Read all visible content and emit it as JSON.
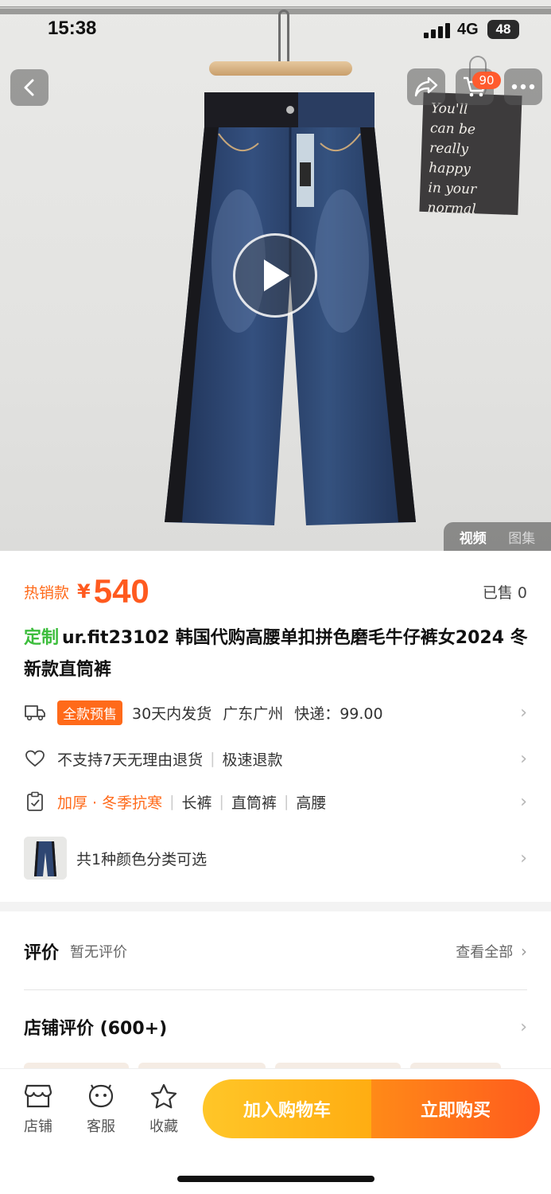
{
  "status_bar": {
    "time": "15:38",
    "network": "4G",
    "battery": "48"
  },
  "top_nav": {
    "cart_badge": "90"
  },
  "hero": {
    "card_text": [
      "You'll",
      "can be really",
      "happy",
      "in your",
      "normal"
    ],
    "media_tabs": [
      "视频",
      "图集"
    ],
    "active_tab": "视频"
  },
  "product": {
    "hot_label": "热销款",
    "currency": "¥",
    "price": "540",
    "sold": "已售 0",
    "title_tag": "定制",
    "title": "ur.fit23102 韩国代购高腰单扣拼色磨毛牛仔裤女2024 冬新款直筒裤"
  },
  "shipping": {
    "presale_badge": "全款预售",
    "ship_time": "30天内发货",
    "location": "广东广州",
    "express": "快递：99.00"
  },
  "service": {
    "no_return": "不支持7天无理由退货",
    "refund": "极速退款"
  },
  "features": {
    "highlight": "加厚 · 冬季抗寒",
    "tags": [
      "长裤",
      "直筒裤",
      "高腰"
    ]
  },
  "variants": {
    "summary": "共1种颜色分类可选"
  },
  "reviews": {
    "title": "评价",
    "status": "暂无评价",
    "view_all": "查看全部"
  },
  "store_reviews": {
    "title": "店铺评价 (600+)"
  },
  "bottom_bar": {
    "store": "店铺",
    "service": "客服",
    "favorite": "收藏",
    "add_to_cart": "加入购物车",
    "buy_now": "立即购买"
  },
  "colors": {
    "accent": "#ff5a1f",
    "presale": "#ff6a1a",
    "custom_tag": "#3cbd3c",
    "cart_button": "#ffb31a",
    "buy_button": "#ff6b1d"
  }
}
